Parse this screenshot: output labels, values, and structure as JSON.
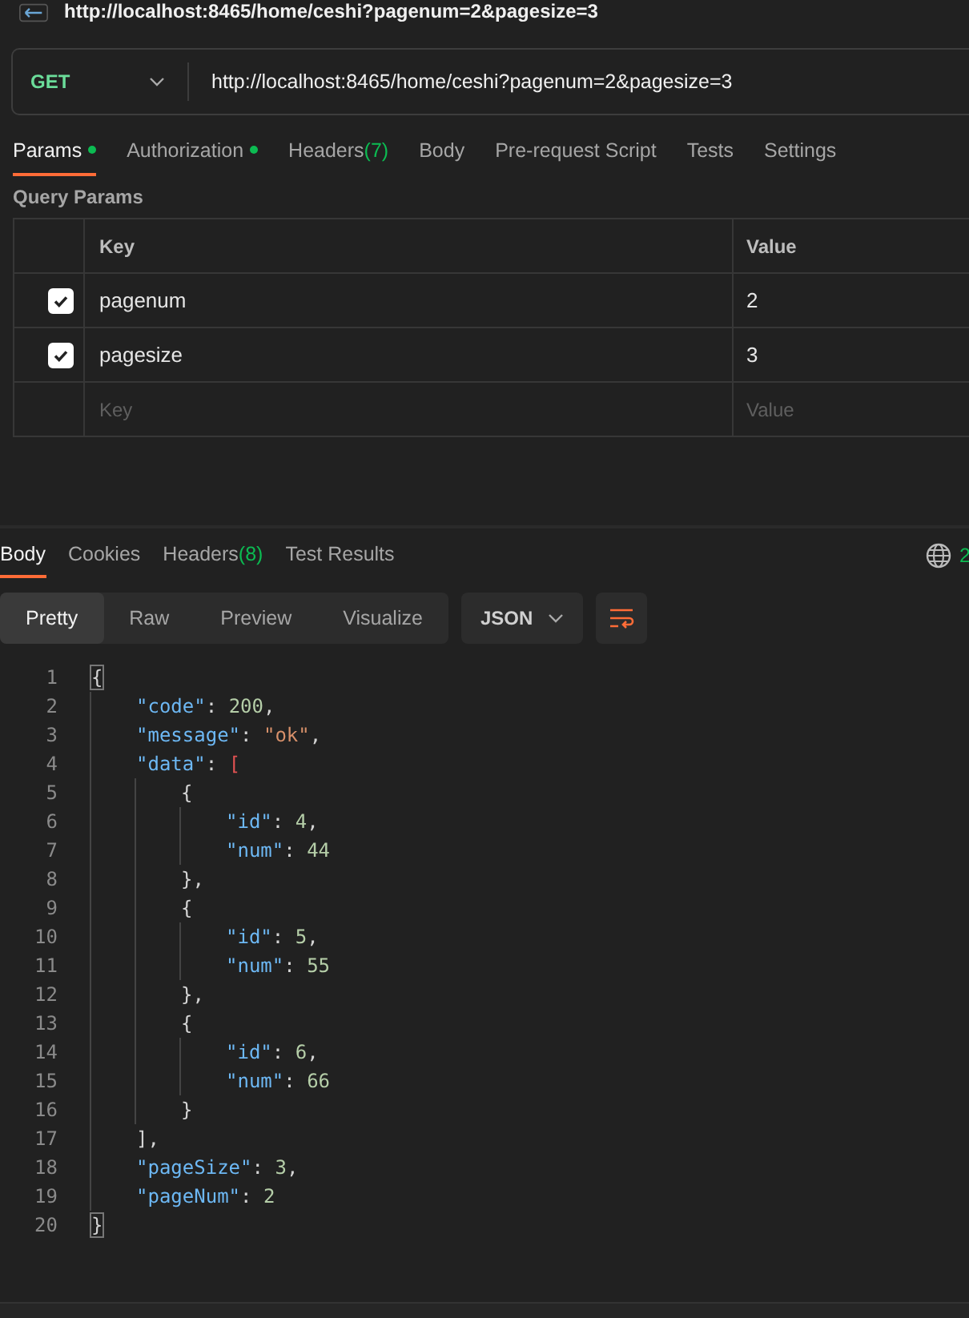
{
  "title": "http://localhost:8465/home/ceshi?pagenum=2&pagesize=3",
  "request": {
    "method": "GET",
    "url": "http://localhost:8465/home/ceshi?pagenum=2&pagesize=3"
  },
  "request_tabs": [
    {
      "label": "Params",
      "dot": true,
      "selected": true
    },
    {
      "label": "Authorization",
      "dot": true,
      "selected": false
    },
    {
      "label": "Headers",
      "count": "(7)",
      "dot": false,
      "selected": false
    },
    {
      "label": "Body",
      "dot": false,
      "selected": false
    },
    {
      "label": "Pre-request Script",
      "dot": false,
      "selected": false
    },
    {
      "label": "Tests",
      "dot": false,
      "selected": false
    },
    {
      "label": "Settings",
      "dot": false,
      "selected": false
    }
  ],
  "section_title": "Query Params",
  "params_table": {
    "columns": [
      "Key",
      "Value"
    ],
    "rows": [
      {
        "checked": true,
        "key": "pagenum",
        "value": "2"
      },
      {
        "checked": true,
        "key": "pagesize",
        "value": "3"
      }
    ],
    "new_row": {
      "key": {
        "placeholder": "Key"
      },
      "value": {
        "placeholder": "Value"
      }
    }
  },
  "response_tabs": [
    {
      "label": "Body",
      "selected": true
    },
    {
      "label": "Cookies",
      "selected": false
    },
    {
      "label": "Headers",
      "count": "(8)",
      "selected": false
    },
    {
      "label": "Test Results",
      "selected": false
    }
  ],
  "status": "2",
  "view_modes": [
    {
      "label": "Pretty",
      "selected": true
    },
    {
      "label": "Raw",
      "selected": false
    },
    {
      "label": "Preview",
      "selected": false
    },
    {
      "label": "Visualize",
      "selected": false
    }
  ],
  "format": "JSON",
  "code": [
    {
      "number": "1",
      "tokens": [
        {
          "kind": "match",
          "text": "{"
        }
      ],
      "children": [
        {
          "number": "2",
          "tokens": [
            {
              "kind": "key",
              "text": "\"code\""
            },
            {
              "kind": "punct",
              "text": ": "
            },
            {
              "kind": "number",
              "text": "200"
            },
            {
              "kind": "punct",
              "text": ","
            }
          ]
        },
        {
          "number": "3",
          "tokens": [
            {
              "kind": "key",
              "text": "\"message\""
            },
            {
              "kind": "punct",
              "text": ": "
            },
            {
              "kind": "string",
              "text": "\"ok\""
            },
            {
              "kind": "punct",
              "text": ","
            }
          ]
        },
        {
          "number": "4",
          "tokens": [
            {
              "kind": "key",
              "text": "\"data\""
            },
            {
              "kind": "punct",
              "text": ": "
            },
            {
              "kind": "bracket",
              "text": "["
            }
          ],
          "children": [
            {
              "number": "5",
              "tokens": [
                {
                  "kind": "punct",
                  "text": "{"
                }
              ],
              "children": [
                {
                  "number": "6",
                  "tokens": [
                    {
                      "kind": "key",
                      "text": "\"id\""
                    },
                    {
                      "kind": "punct",
                      "text": ": "
                    },
                    {
                      "kind": "number",
                      "text": "4"
                    },
                    {
                      "kind": "punct",
                      "text": ","
                    }
                  ]
                },
                {
                  "number": "7",
                  "tokens": [
                    {
                      "kind": "key",
                      "text": "\"num\""
                    },
                    {
                      "kind": "punct",
                      "text": ": "
                    },
                    {
                      "kind": "number",
                      "text": "44"
                    }
                  ]
                }
              ]
            },
            {
              "number": "8",
              "tokens": [
                {
                  "kind": "punct",
                  "text": "},"
                }
              ]
            },
            {
              "number": "9",
              "tokens": [
                {
                  "kind": "punct",
                  "text": "{"
                }
              ],
              "children": [
                {
                  "number": "10",
                  "tokens": [
                    {
                      "kind": "key",
                      "text": "\"id\""
                    },
                    {
                      "kind": "punct",
                      "text": ": "
                    },
                    {
                      "kind": "number",
                      "text": "5"
                    },
                    {
                      "kind": "punct",
                      "text": ","
                    }
                  ]
                },
                {
                  "number": "11",
                  "tokens": [
                    {
                      "kind": "key",
                      "text": "\"num\""
                    },
                    {
                      "kind": "punct",
                      "text": ": "
                    },
                    {
                      "kind": "number",
                      "text": "55"
                    }
                  ]
                }
              ]
            },
            {
              "number": "12",
              "tokens": [
                {
                  "kind": "punct",
                  "text": "},"
                }
              ]
            },
            {
              "number": "13",
              "tokens": [
                {
                  "kind": "punct",
                  "text": "{"
                }
              ],
              "children": [
                {
                  "number": "14",
                  "tokens": [
                    {
                      "kind": "key",
                      "text": "\"id\""
                    },
                    {
                      "kind": "punct",
                      "text": ": "
                    },
                    {
                      "kind": "number",
                      "text": "6"
                    },
                    {
                      "kind": "punct",
                      "text": ","
                    }
                  ]
                },
                {
                  "number": "15",
                  "tokens": [
                    {
                      "kind": "key",
                      "text": "\"num\""
                    },
                    {
                      "kind": "punct",
                      "text": ": "
                    },
                    {
                      "kind": "number",
                      "text": "66"
                    }
                  ]
                }
              ]
            },
            {
              "number": "16",
              "tokens": [
                {
                  "kind": "punct",
                  "text": "}"
                }
              ]
            }
          ]
        },
        {
          "number": "17",
          "tokens": [
            {
              "kind": "punct",
              "text": "],"
            }
          ]
        },
        {
          "number": "18",
          "tokens": [
            {
              "kind": "key",
              "text": "\"pageSize\""
            },
            {
              "kind": "punct",
              "text": ": "
            },
            {
              "kind": "number",
              "text": "3"
            },
            {
              "kind": "punct",
              "text": ","
            }
          ]
        },
        {
          "number": "19",
          "tokens": [
            {
              "kind": "key",
              "text": "\"pageNum\""
            },
            {
              "kind": "punct",
              "text": ": "
            },
            {
              "kind": "number",
              "text": "2"
            }
          ]
        }
      ]
    },
    {
      "number": "20",
      "tokens": [
        {
          "kind": "match",
          "text": "}"
        }
      ]
    }
  ]
}
